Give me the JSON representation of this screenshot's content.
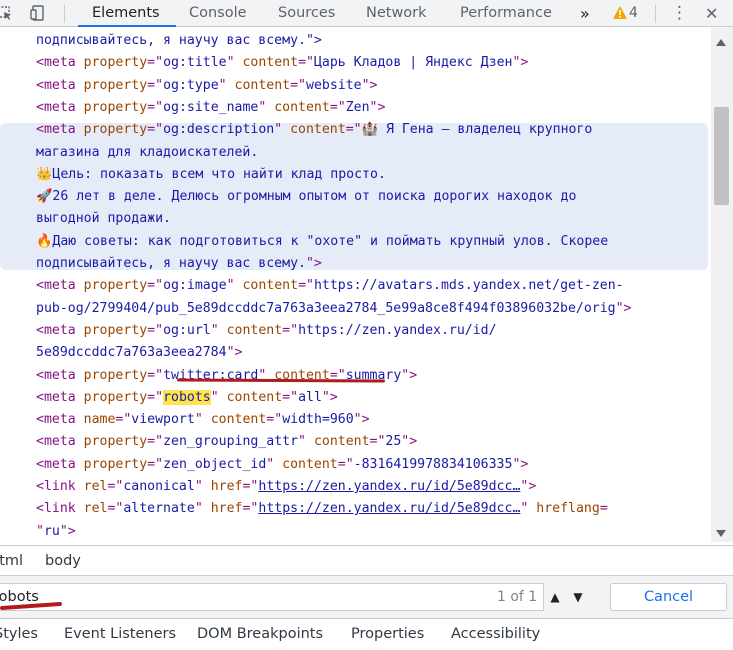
{
  "toolbar": {
    "tabs": [
      {
        "label": "Elements",
        "active": true
      },
      {
        "label": "Console"
      },
      {
        "label": "Sources"
      },
      {
        "label": "Network"
      },
      {
        "label": "Performance"
      }
    ],
    "more_tabs": "»",
    "warnings_count": "4",
    "kebab": "⋮",
    "close": "✕",
    "icons": [
      "inspect-icon",
      "device-toolbar-icon",
      "warning-icon",
      "kebab-menu-icon",
      "close-icon"
    ],
    "accent": "#1a73e8"
  },
  "code": {
    "lines": [
      [
        {
          "t": "tx",
          "v": "подписывайтесь, я научу вас всему.\">"
        }
      ],
      [
        {
          "t": "tg",
          "v": "<meta "
        },
        {
          "t": "an",
          "v": "property"
        },
        {
          "t": "tg",
          "v": "=\""
        },
        {
          "t": "av",
          "v": "og:title"
        },
        {
          "t": "tg",
          "v": "\" "
        },
        {
          "t": "an",
          "v": "content"
        },
        {
          "t": "tg",
          "v": "=\""
        },
        {
          "t": "av",
          "v": "Царь Кладов | Яндекс Дзен"
        },
        {
          "t": "tg",
          "v": "\">"
        }
      ],
      [
        {
          "t": "tg",
          "v": "<meta "
        },
        {
          "t": "an",
          "v": "property"
        },
        {
          "t": "tg",
          "v": "=\""
        },
        {
          "t": "av",
          "v": "og:type"
        },
        {
          "t": "tg",
          "v": "\" "
        },
        {
          "t": "an",
          "v": "content"
        },
        {
          "t": "tg",
          "v": "=\""
        },
        {
          "t": "av",
          "v": "website"
        },
        {
          "t": "tg",
          "v": "\">"
        }
      ],
      [
        {
          "t": "tg",
          "v": "<meta "
        },
        {
          "t": "an",
          "v": "property"
        },
        {
          "t": "tg",
          "v": "=\""
        },
        {
          "t": "av",
          "v": "og:site_name"
        },
        {
          "t": "tg",
          "v": "\" "
        },
        {
          "t": "an",
          "v": "content"
        },
        {
          "t": "tg",
          "v": "=\""
        },
        {
          "t": "av",
          "v": "Zen"
        },
        {
          "t": "tg",
          "v": "\">"
        }
      ],
      [
        {
          "t": "tg",
          "v": "<meta "
        },
        {
          "t": "an",
          "v": "property"
        },
        {
          "t": "tg",
          "v": "=\""
        },
        {
          "t": "av",
          "v": "og:description"
        },
        {
          "t": "tg",
          "v": "\" "
        },
        {
          "t": "an",
          "v": "content"
        },
        {
          "t": "tg",
          "v": "=\""
        },
        {
          "t": "av",
          "v": "🏰 Я Гена – владелец крупного"
        }
      ],
      [
        {
          "t": "av",
          "v": "магазина для кладоискателей."
        }
      ],
      [
        {
          "t": "av",
          "v": "👑Цель: показать всем что найти клад просто."
        }
      ],
      [
        {
          "t": "av",
          "v": "🚀26 лет в деле. Делюсь огромным опытом от поиска дорогих находок до"
        }
      ],
      [
        {
          "t": "av",
          "v": "выгодной продажи."
        }
      ],
      [
        {
          "t": "av",
          "v": "🔥Даю советы: как подготовиться к \"охоте\" и поймать крупный улов. Скорее"
        }
      ],
      [
        {
          "t": "av",
          "v": "подписывайтесь, я научу вас всему."
        },
        {
          "t": "tg",
          "v": "\">"
        }
      ],
      [
        {
          "t": "tg",
          "v": "<meta "
        },
        {
          "t": "an",
          "v": "property"
        },
        {
          "t": "tg",
          "v": "=\""
        },
        {
          "t": "av",
          "v": "og:image"
        },
        {
          "t": "tg",
          "v": "\" "
        },
        {
          "t": "an",
          "v": "content"
        },
        {
          "t": "tg",
          "v": "=\""
        },
        {
          "t": "av",
          "v": "https://avatars.mds.yandex.net/get-zen-"
        }
      ],
      [
        {
          "t": "av",
          "v": "pub-og/2799404/pub_5e89dccddc7a763a3eea2784_5e99a8ce8f494f03896032be/orig"
        },
        {
          "t": "tg",
          "v": "\">"
        }
      ],
      [
        {
          "t": "tg",
          "v": "<meta "
        },
        {
          "t": "an",
          "v": "property"
        },
        {
          "t": "tg",
          "v": "=\""
        },
        {
          "t": "av",
          "v": "og:url"
        },
        {
          "t": "tg",
          "v": "\" "
        },
        {
          "t": "an",
          "v": "content"
        },
        {
          "t": "tg",
          "v": "=\""
        },
        {
          "t": "av",
          "v": "https://zen.yandex.ru/id/"
        }
      ],
      [
        {
          "t": "av",
          "v": "5e89dccddc7a763a3eea2784"
        },
        {
          "t": "tg",
          "v": "\">"
        }
      ],
      [
        {
          "t": "tg",
          "v": "<meta "
        },
        {
          "t": "an",
          "v": "property"
        },
        {
          "t": "tg",
          "v": "=\""
        },
        {
          "t": "av",
          "v": "twitter:card"
        },
        {
          "t": "tg",
          "v": "\" "
        },
        {
          "t": "an",
          "v": "content"
        },
        {
          "t": "tg",
          "v": "=\""
        },
        {
          "t": "av",
          "v": "summary"
        },
        {
          "t": "tg",
          "v": "\">"
        }
      ],
      [
        {
          "t": "tg",
          "v": "<meta "
        },
        {
          "t": "an",
          "v": "property"
        },
        {
          "t": "tg",
          "v": "=\""
        },
        {
          "t": "hit",
          "v": "robots"
        },
        {
          "t": "tg",
          "v": "\" "
        },
        {
          "t": "an",
          "v": "content"
        },
        {
          "t": "tg",
          "v": "=\""
        },
        {
          "t": "av",
          "v": "all"
        },
        {
          "t": "tg",
          "v": "\">"
        }
      ],
      [
        {
          "t": "tg",
          "v": "<meta "
        },
        {
          "t": "an",
          "v": "name"
        },
        {
          "t": "tg",
          "v": "=\""
        },
        {
          "t": "av",
          "v": "viewport"
        },
        {
          "t": "tg",
          "v": "\" "
        },
        {
          "t": "an",
          "v": "content"
        },
        {
          "t": "tg",
          "v": "=\""
        },
        {
          "t": "av",
          "v": "width=960"
        },
        {
          "t": "tg",
          "v": "\">"
        }
      ],
      [
        {
          "t": "tg",
          "v": "<meta "
        },
        {
          "t": "an",
          "v": "property"
        },
        {
          "t": "tg",
          "v": "=\""
        },
        {
          "t": "av",
          "v": "zen_grouping_attr"
        },
        {
          "t": "tg",
          "v": "\" "
        },
        {
          "t": "an",
          "v": "content"
        },
        {
          "t": "tg",
          "v": "=\""
        },
        {
          "t": "av",
          "v": "25"
        },
        {
          "t": "tg",
          "v": "\">"
        }
      ],
      [
        {
          "t": "tg",
          "v": "<meta "
        },
        {
          "t": "an",
          "v": "property"
        },
        {
          "t": "tg",
          "v": "=\""
        },
        {
          "t": "av",
          "v": "zen_object_id"
        },
        {
          "t": "tg",
          "v": "\" "
        },
        {
          "t": "an",
          "v": "content"
        },
        {
          "t": "tg",
          "v": "=\""
        },
        {
          "t": "av",
          "v": "-8316419978834106335"
        },
        {
          "t": "tg",
          "v": "\">"
        }
      ],
      [
        {
          "t": "tg",
          "v": "<link "
        },
        {
          "t": "an",
          "v": "rel"
        },
        {
          "t": "tg",
          "v": "=\""
        },
        {
          "t": "av",
          "v": "canonical"
        },
        {
          "t": "tg",
          "v": "\" "
        },
        {
          "t": "an",
          "v": "href"
        },
        {
          "t": "tg",
          "v": "=\""
        },
        {
          "t": "link",
          "v": "https://zen.yandex.ru/id/5e89dcc…"
        },
        {
          "t": "tg",
          "v": "\">"
        }
      ],
      [
        {
          "t": "tg",
          "v": "<link "
        },
        {
          "t": "an",
          "v": "rel"
        },
        {
          "t": "tg",
          "v": "=\""
        },
        {
          "t": "av",
          "v": "alternate"
        },
        {
          "t": "tg",
          "v": "\" "
        },
        {
          "t": "an",
          "v": "href"
        },
        {
          "t": "tg",
          "v": "=\""
        },
        {
          "t": "link",
          "v": "https://zen.yandex.ru/id/5e89dcc…"
        },
        {
          "t": "tg",
          "v": "\" "
        },
        {
          "t": "an",
          "v": "hreflang"
        },
        {
          "t": "tg",
          "v": "="
        }
      ],
      [
        {
          "t": "tg",
          "v": "\""
        },
        {
          "t": "av",
          "v": "ru"
        },
        {
          "t": "tg",
          "v": "\">"
        }
      ]
    ]
  },
  "breadcrumbs": [
    "html",
    "body"
  ],
  "search": {
    "query": "robots",
    "count": "1 of 1",
    "prev": "▲",
    "next": "▼",
    "cancel_label": "Cancel"
  },
  "bottom_tabs": [
    "Styles",
    "Event Listeners",
    "DOM Breakpoints",
    "Properties",
    "Accessibility"
  ]
}
